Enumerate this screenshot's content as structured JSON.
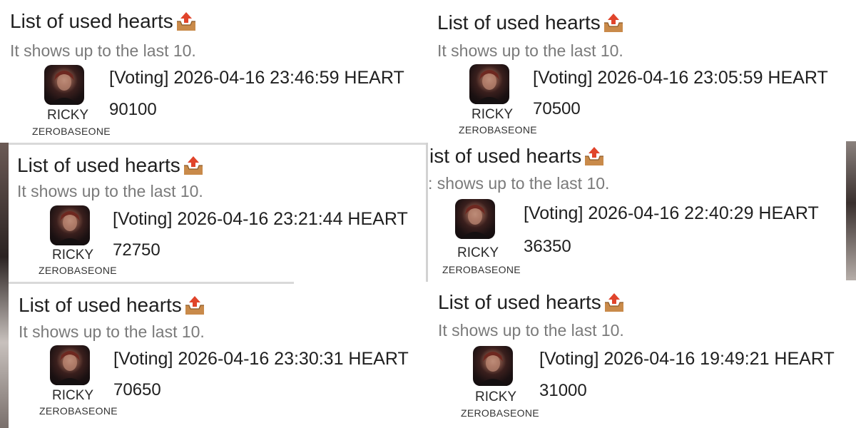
{
  "colors": {
    "title_text": "#1f1f1f",
    "subtitle_text": "#7a7a7a",
    "icon_tray": "#c98a4a",
    "icon_arrow": "#e0442b"
  },
  "icons": {
    "title_icon": "outbox-tray-icon"
  },
  "cards": [
    {
      "title": "List of used hearts",
      "subtitle": "It shows up to the last 10.",
      "artist": "RICKY",
      "group": "ZEROBASEONE",
      "entry": "[Voting] 2026-04-16 23:46:59 HEART",
      "amount": "90100"
    },
    {
      "title": "List of used hearts",
      "subtitle": "It shows up to the last 10.",
      "artist": "RICKY",
      "group": "ZEROBASEONE",
      "entry": "[Voting] 2026-04-16 23:05:59 HEART",
      "amount": "70500"
    },
    {
      "title": "List of used hearts",
      "subtitle": "It shows up to the last 10.",
      "artist": "RICKY",
      "group": "ZEROBASEONE",
      "entry": "[Voting] 2026-04-16 23:21:44 HEART",
      "amount": "72750"
    },
    {
      "title": "ist of used hearts",
      "subtitle": ": shows up to the last 10.",
      "artist": "RICKY",
      "group": "ZEROBASEONE",
      "entry": "[Voting] 2026-04-16 22:40:29 HEART",
      "amount": "36350"
    },
    {
      "title": "List of used hearts",
      "subtitle": "It shows up to the last 10.",
      "artist": "RICKY",
      "group": "ZEROBASEONE",
      "entry": "[Voting] 2026-04-16 23:30:31 HEART",
      "amount": "70650"
    },
    {
      "title": "List of used hearts",
      "subtitle": "It shows up to the last 10.",
      "artist": "RICKY",
      "group": "ZEROBASEONE",
      "entry": "[Voting] 2026-04-16 19:49:21 HEART",
      "amount": "31000"
    }
  ]
}
